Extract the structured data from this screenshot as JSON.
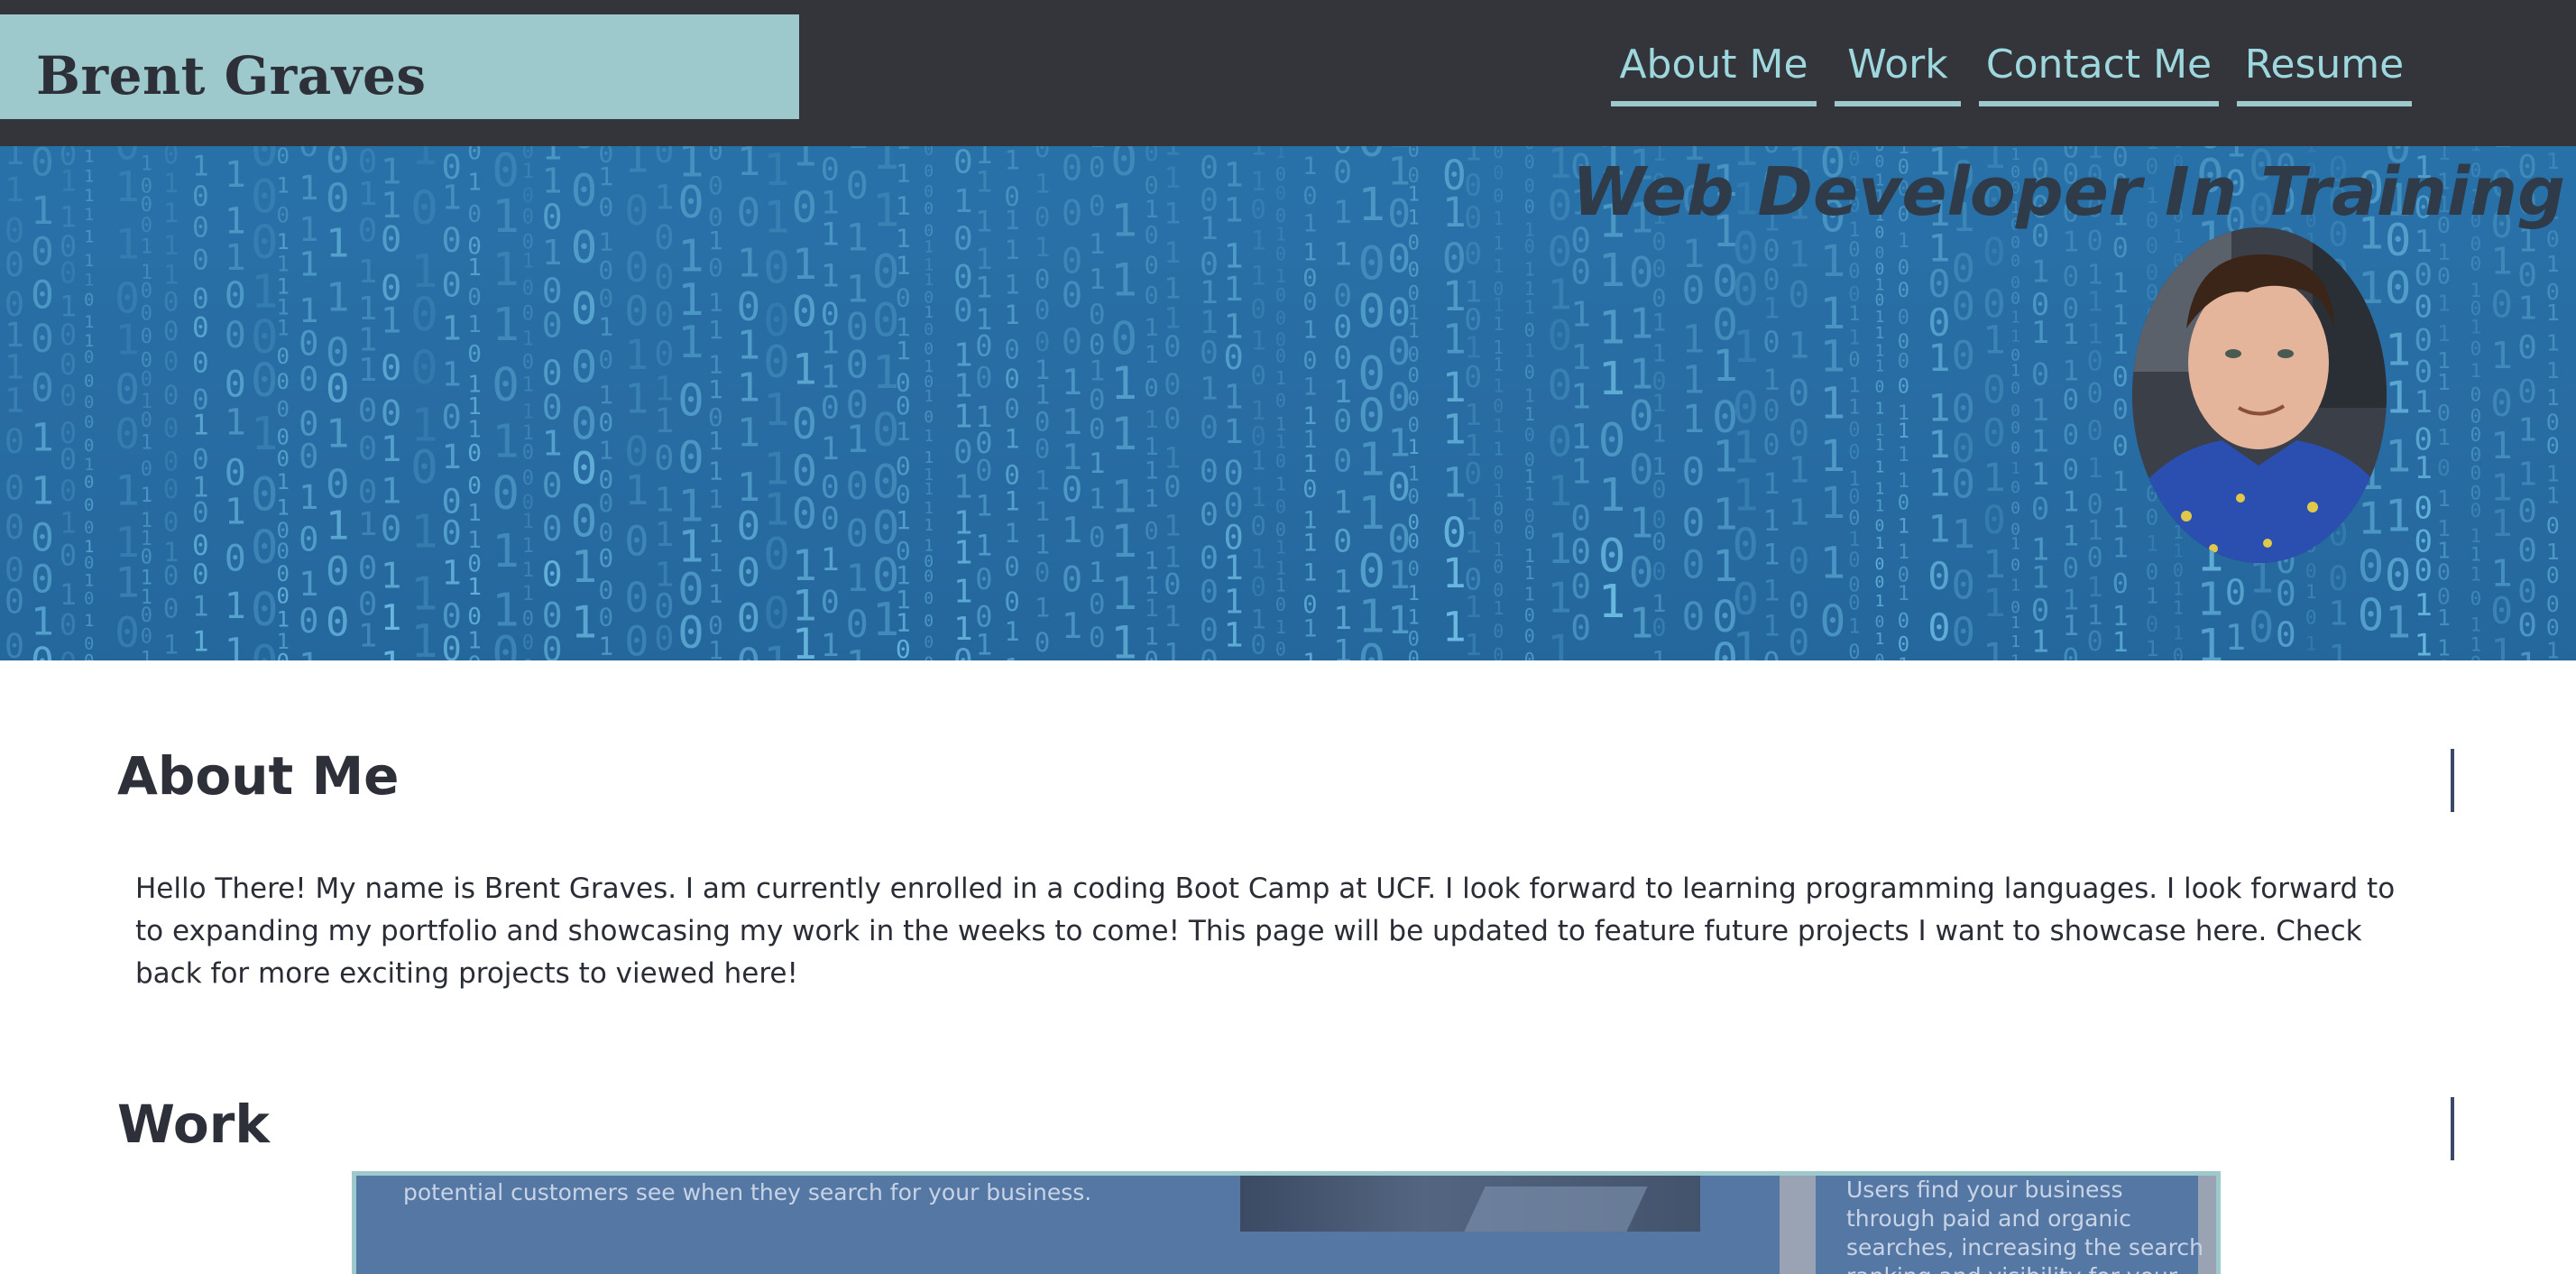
{
  "header": {
    "brand": "Brent Graves",
    "nav": [
      {
        "label": "About Me"
      },
      {
        "label": "Work"
      },
      {
        "label": "Contact Me"
      },
      {
        "label": "Resume"
      }
    ]
  },
  "hero": {
    "title": "Web Developer In Training"
  },
  "about": {
    "heading": "About Me",
    "body": "Hello There! My name is Brent Graves. I am currently enrolled in a coding Boot Camp at UCF. I look forward to learning programming languages. I look forward to to expanding my portfolio and showcasing my work in the weeks to come! This page will be updated to feature future projects I want to showcase here. Check back for more exciting projects to viewed here!"
  },
  "work": {
    "heading": "Work",
    "card_text_left": "potential customers see when they search for your business.",
    "card_text_right": "Users find your business through paid and organic searches, increasing the search ranking and visibility for your business."
  },
  "colors": {
    "topbar": "#33353b",
    "accent": "#9ec9cc",
    "nav_text": "#9ed8de",
    "hero_blue": "#2a6fa6",
    "heading": "#2d3038",
    "card_blue": "#5577a4"
  }
}
